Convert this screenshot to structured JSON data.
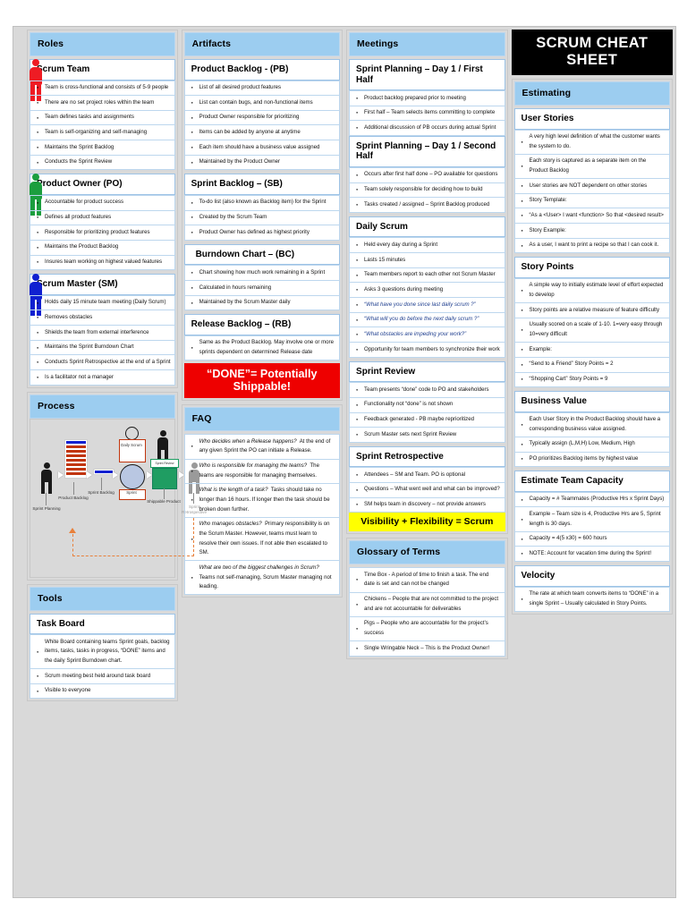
{
  "title": "SCRUM CHEAT SHEET",
  "colors": {
    "band_blue": "#9ccdf0",
    "done_red": "#ee0000",
    "highlight_yellow": "#ffff00",
    "title_black": "#000000",
    "scrum_team_figure": "#ee1c24",
    "product_owner_figure": "#1b9e3e",
    "scrum_master_figure": "#1020d0"
  },
  "roles": {
    "band": "Roles",
    "groups": [
      {
        "title": "Scrum Team",
        "figure_color": "#ee1c24",
        "items": [
          "Team is cross-functional and consists of 5-9 people",
          "There are no set project roles within the team",
          "Team defines tasks and assignments",
          "Team is self-organizing and self-managing",
          "Maintains the Sprint Backlog",
          "Conducts the Sprint Review"
        ]
      },
      {
        "title": "Product Owner (PO)",
        "figure_color": "#1b9e3e",
        "items": [
          "Accountable for product success",
          "Defines all product features",
          "Responsible for prioritizing product features",
          "Maintains the Product Backlog",
          "Insures team working on highest valued features"
        ]
      },
      {
        "title": "Scrum Master (SM)",
        "figure_color": "#1020d0",
        "items": [
          "Holds daily 15 minute  team meeting (Daily Scrum)",
          "Removes obstacles",
          "Shields the team from external interference",
          "Maintains the Sprint Burndown Chart",
          "Conducts Sprint Retrospective at the end of a Sprint",
          "Is a facilitator not a manager"
        ]
      }
    ]
  },
  "process": {
    "band": "Process",
    "nodes": [
      "Sprint Planning",
      "Product Backlog",
      "Sprint Backlog",
      "Daily Scrum",
      "Sprint",
      "Sprint Review",
      "Shippable Product",
      "Sprint Retrospective"
    ]
  },
  "tools": {
    "band": "Tools",
    "groups": [
      {
        "title": "Task Board",
        "items": [
          "White Board containing teams Sprint goals, backlog items, tasks, tasks in progress, “DONE” items and the daily Sprint Burndown chart.",
          "Scrum meeting best held around task board",
          "Visible to everyone"
        ]
      }
    ]
  },
  "artifacts": {
    "band": "Artifacts",
    "groups": [
      {
        "title": "Product Backlog - (PB)",
        "items": [
          "List of all desired product features",
          "List can contain bugs, and non-functional items",
          "Product Owner responsible for prioritizing",
          "Items can be added by anyone at anytime",
          "Each item should have a business value assigned",
          "Maintained by the Product Owner"
        ]
      },
      {
        "title": "Sprint Backlog – (SB)",
        "items": [
          "To-do list (also known as Backlog item) for the Sprint",
          "Created by the Scrum Team",
          "Product Owner has defined as highest priority"
        ]
      },
      {
        "title": "Burndown Chart – (BC)",
        "items": [
          "Chart showing how much work remaining in a Sprint",
          "Calculated in hours remaining",
          "Maintained by the Scrum Master daily"
        ]
      },
      {
        "title": "Release Backlog – (RB)",
        "items": [
          "Same as the Product Backlog. May involve one or more sprints dependent on determined Release date"
        ]
      }
    ],
    "done_banner": "“DONE”= Potentially Shippable!"
  },
  "faq": {
    "band": "FAQ",
    "items": [
      {
        "q": "Who decides when a Release happens?",
        "a": "At the end of any given Sprint the PO can initiate a Release."
      },
      {
        "q": "Who is responsible for managing the teams?",
        "a": "The teams are responsible for managing themselves."
      },
      {
        "q": "What is the length of a task?",
        "a": "Tasks should take no longer than 16 hours. If longer then the task should be broken down further."
      },
      {
        "q": "Who manages obstacles?",
        "a": "Primary responsibility is on the Scrum Master.  However, teams must learn to resolve their own issues.  If not able then escalated to SM."
      },
      {
        "q": "What are two of the biggest challenges in Scrum?",
        "a": "Teams not self-managing, Scrum Master managing not leading."
      }
    ]
  },
  "meetings": {
    "band": "Meetings",
    "groups": [
      {
        "title": "Sprint Planning – Day 1 / First Half",
        "items": [
          "Product backlog prepared prior to meeting",
          "First half – Team selects items committing to complete",
          "Additional discussion of PB occurs during actual Sprint"
        ]
      },
      {
        "title": "Sprint Planning – Day 1 / Second Half",
        "items": [
          "Occurs after first half done – PO available for questions",
          "Team solely responsible for deciding how to build",
          "Tasks created / assigned – Sprint Backlog produced"
        ]
      },
      {
        "title": "Daily Scrum",
        "items": [
          "Held every day during a Sprint",
          "Lasts 15 minutes",
          "Team members report to each other not Scrum Master",
          "Asks 3 questions during meeting"
        ],
        "questions": [
          "“What have you done since last daily scrum ?”",
          "“What will you do before the next daily scrum ?”",
          "“What obstacles are impeding your work?”"
        ],
        "items_after": [
          "Opportunity for team members to synchronize their work"
        ]
      },
      {
        "title": "Sprint Review",
        "items": [
          "Team presents “done” code to PO and stakeholders",
          "Functionality not “done” is not shown",
          "Feedback generated -  PB maybe reprioritized",
          "Scrum Master sets next Sprint Review"
        ]
      },
      {
        "title": "Sprint Retrospective",
        "items": [
          "Attendees – SM and Team.  PO is optional",
          "Questions – What went well and what can be improved?",
          "SM helps team in discovery – not provide answers"
        ]
      }
    ],
    "visibility_banner": "Visibility + Flexibility = Scrum"
  },
  "glossary": {
    "band": "Glossary of Terms",
    "items": [
      "Time Box -  A period of time to finish a task. The end date is set and can not be changed",
      "Chickens – People that are not committed to the project and are not accountable for deliverables",
      "Pigs – People who are accountable for the project’s success",
      "Single Wringable Neck – This is the Product Owner!"
    ]
  },
  "estimating": {
    "band": "Estimating",
    "groups": [
      {
        "title": "User Stories",
        "items": [
          "A very high level definition of what the customer wants the system to do.",
          "Each story is captured as a separate item on the Product Backlog",
          "User stories are NOT dependent on other stories",
          "Story Template:",
          "“As a <User> I want <function> So that <desired result>",
          "Story Example:",
          "As a user, I want to print a recipe so that I can cook it."
        ]
      },
      {
        "title": "Story Points",
        "items": [
          "A simple way to initially estimate level of effort expected to develop",
          "Story points are a relative measure of feature difficulty",
          "Usually scored on a scale of 1-10.  1=very easy through 10=very difficult",
          "Example:",
          "“Send to a Friend” Story Points = 2",
          "“Shopping Cart” Story Points = 9"
        ]
      },
      {
        "title": "Business Value",
        "items": [
          "Each User Story in the Product Backlog should have a corresponding business value assigned.",
          "Typically assign (L,M,H) Low, Medium, High",
          "PO prioritizes Backlog items by highest value"
        ]
      },
      {
        "title": "Estimate Team Capacity",
        "items": [
          "Capacity = # Teammates (Productive Hrs x Sprint Days)",
          "Example – Team size is 4, Productive Hrs are 5, Sprint length is 30 days.",
          "Capacity = 4(5 x30) = 600 hours",
          "NOTE:  Account for vacation time during the Sprint!"
        ]
      },
      {
        "title": "Velocity",
        "items": [
          "The rate at which team converts items to “DONE” in a single Sprint – Usually calculated in Story Points."
        ]
      }
    ]
  }
}
